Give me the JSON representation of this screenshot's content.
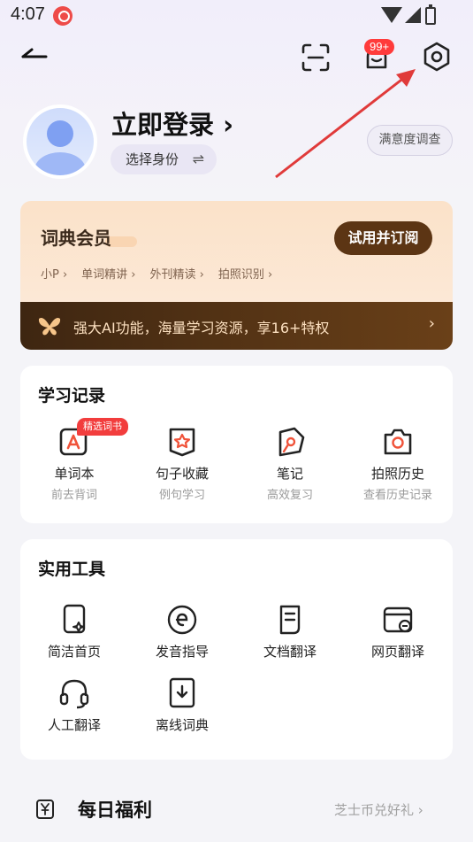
{
  "status_bar": {
    "time": "4:07"
  },
  "header": {
    "badge": "99+"
  },
  "profile": {
    "login_title": "立即登录",
    "login_chevron": "›",
    "role_label": "选择身份",
    "role_swap": "⇌",
    "survey": "满意度调查"
  },
  "vip": {
    "title": "词典会员",
    "button": "试用并订阅",
    "features": [
      "小P ›",
      "单词精讲 ›",
      "外刊精读 ›",
      "拍照识别 ›"
    ],
    "banner": "强大AI功能，海量学习资源，享16+特权",
    "banner_chevron": "›"
  },
  "study": {
    "title": "学习记录",
    "tag": "精选词书",
    "items": [
      {
        "label": "单词本",
        "sub": "前去背词"
      },
      {
        "label": "句子收藏",
        "sub": "例句学习"
      },
      {
        "label": "笔记",
        "sub": "高效复习"
      },
      {
        "label": "拍照历史",
        "sub": "查看历史记录"
      }
    ]
  },
  "tools": {
    "title": "实用工具",
    "items": [
      {
        "label": "简洁首页"
      },
      {
        "label": "发音指导"
      },
      {
        "label": "文档翻译"
      },
      {
        "label": "网页翻译"
      },
      {
        "label": "人工翻译"
      },
      {
        "label": "离线词典"
      }
    ]
  },
  "daily": {
    "title": "每日福利",
    "link": "芝士币兑好礼 ›"
  },
  "colors": {
    "vip_button": "#5c3514",
    "badge": "#ff3b3b",
    "annotation_arrow": "#e03a3a"
  }
}
